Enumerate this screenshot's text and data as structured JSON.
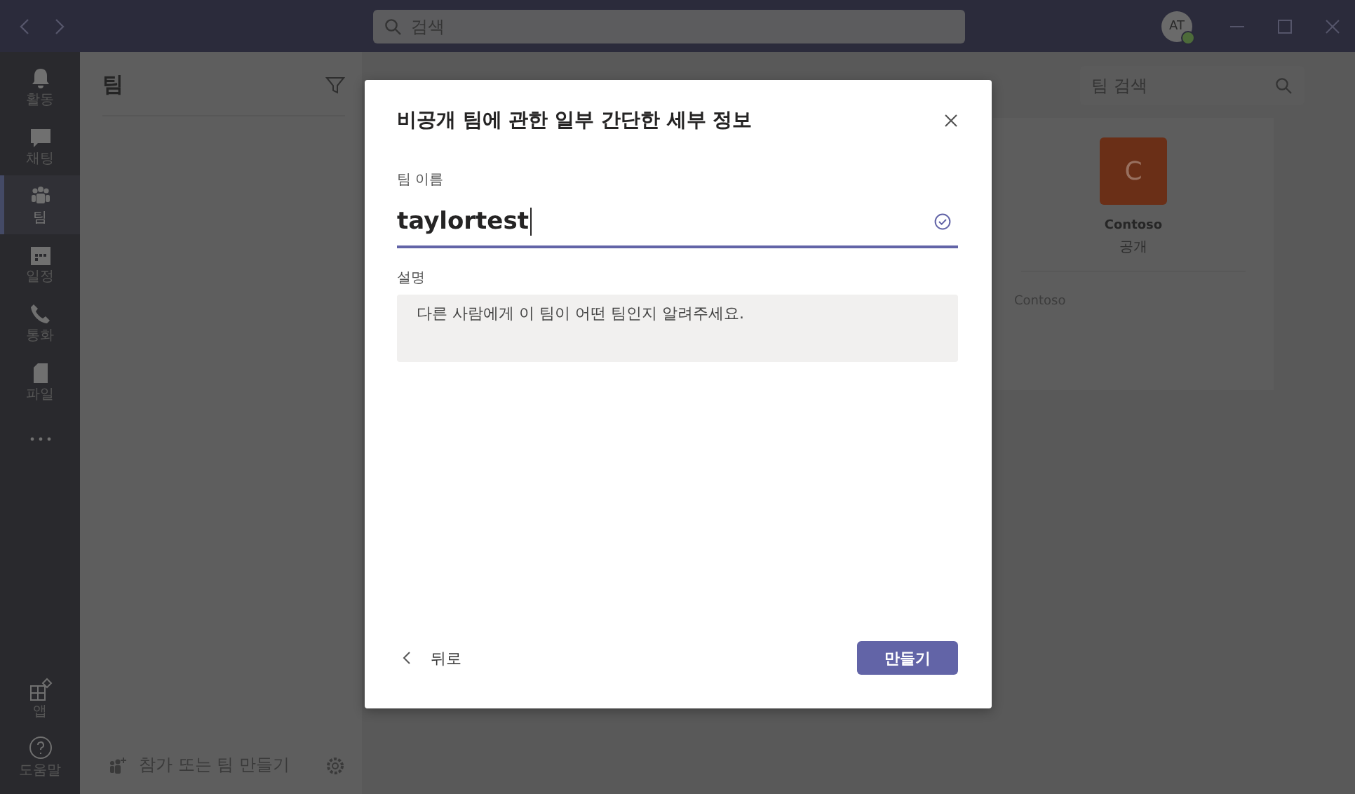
{
  "titlebar": {
    "search": {
      "placeholder": "검색"
    },
    "avatar": "AT"
  },
  "rail": {
    "items": [
      {
        "kind": "bell",
        "label": "활동",
        "selected": false
      },
      {
        "kind": "chat",
        "label": "채팅",
        "selected": false
      },
      {
        "kind": "teams",
        "label": "팀",
        "selected": true
      },
      {
        "kind": "calendar",
        "label": "일정",
        "selected": false
      },
      {
        "kind": "phone",
        "label": "통화",
        "selected": false
      },
      {
        "kind": "file",
        "label": "파일",
        "selected": false
      }
    ],
    "bottom_items": [
      {
        "kind": "apps",
        "label": "앱"
      },
      {
        "kind": "help",
        "label": "도움말"
      }
    ]
  },
  "teams_panel": {
    "title": "팀",
    "join_create": "참가 또는 팀 만들기"
  },
  "main": {
    "search": {
      "placeholder": "팀 검색"
    },
    "team_card": {
      "initial": "C",
      "name": "Contoso",
      "visibility": "공개",
      "description": "Contoso"
    }
  },
  "dialog": {
    "title": "비공개 팀에 관한 일부 간단한 세부 정보",
    "name_label": "팀 이름",
    "name_value": "taylortest",
    "description_label": "설명",
    "description_placeholder": "다른 사람에게 이 팀이 어떤 팀인지 알려주세요.",
    "back": "뒤로",
    "create": "만들기"
  }
}
